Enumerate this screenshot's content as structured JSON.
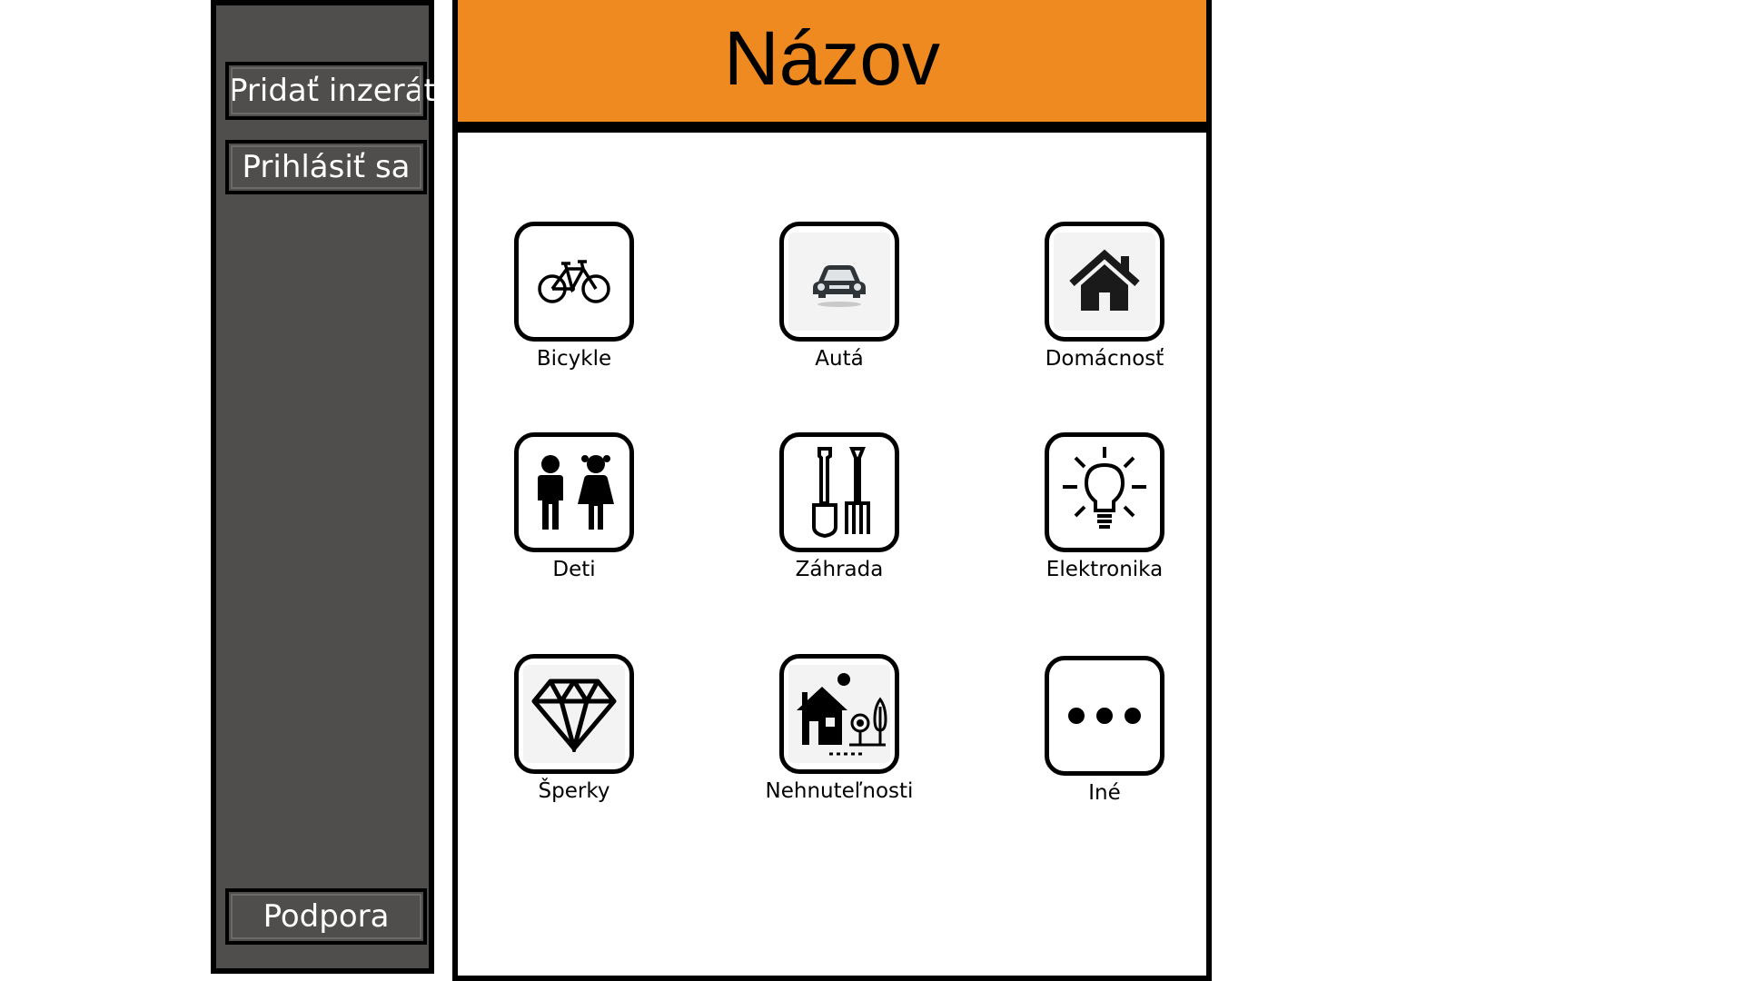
{
  "header": {
    "title": "Názov"
  },
  "sidebar": {
    "add_listing": "Pridať inzerát",
    "login": "Prihlásiť sa",
    "support": "Podpora"
  },
  "categories": [
    {
      "label": "Bicykle",
      "icon": "bicycle-icon"
    },
    {
      "label": "Autá",
      "icon": "car-icon"
    },
    {
      "label": "Domácnosť",
      "icon": "house-icon"
    },
    {
      "label": "Deti",
      "icon": "children-icon"
    },
    {
      "label": "Záhrada",
      "icon": "garden-tools-icon"
    },
    {
      "label": "Elektronika",
      "icon": "lightbulb-icon"
    },
    {
      "label": "Šperky",
      "icon": "diamond-icon"
    },
    {
      "label": "Nehnuteľnosti",
      "icon": "real-estate-icon"
    },
    {
      "label": "Iné",
      "icon": "more-dots-icon"
    }
  ],
  "colors": {
    "header_bg": "#ef8a20",
    "sidebar_bg": "#4f4e4c",
    "text_light": "#ffffff",
    "border": "#000000"
  }
}
